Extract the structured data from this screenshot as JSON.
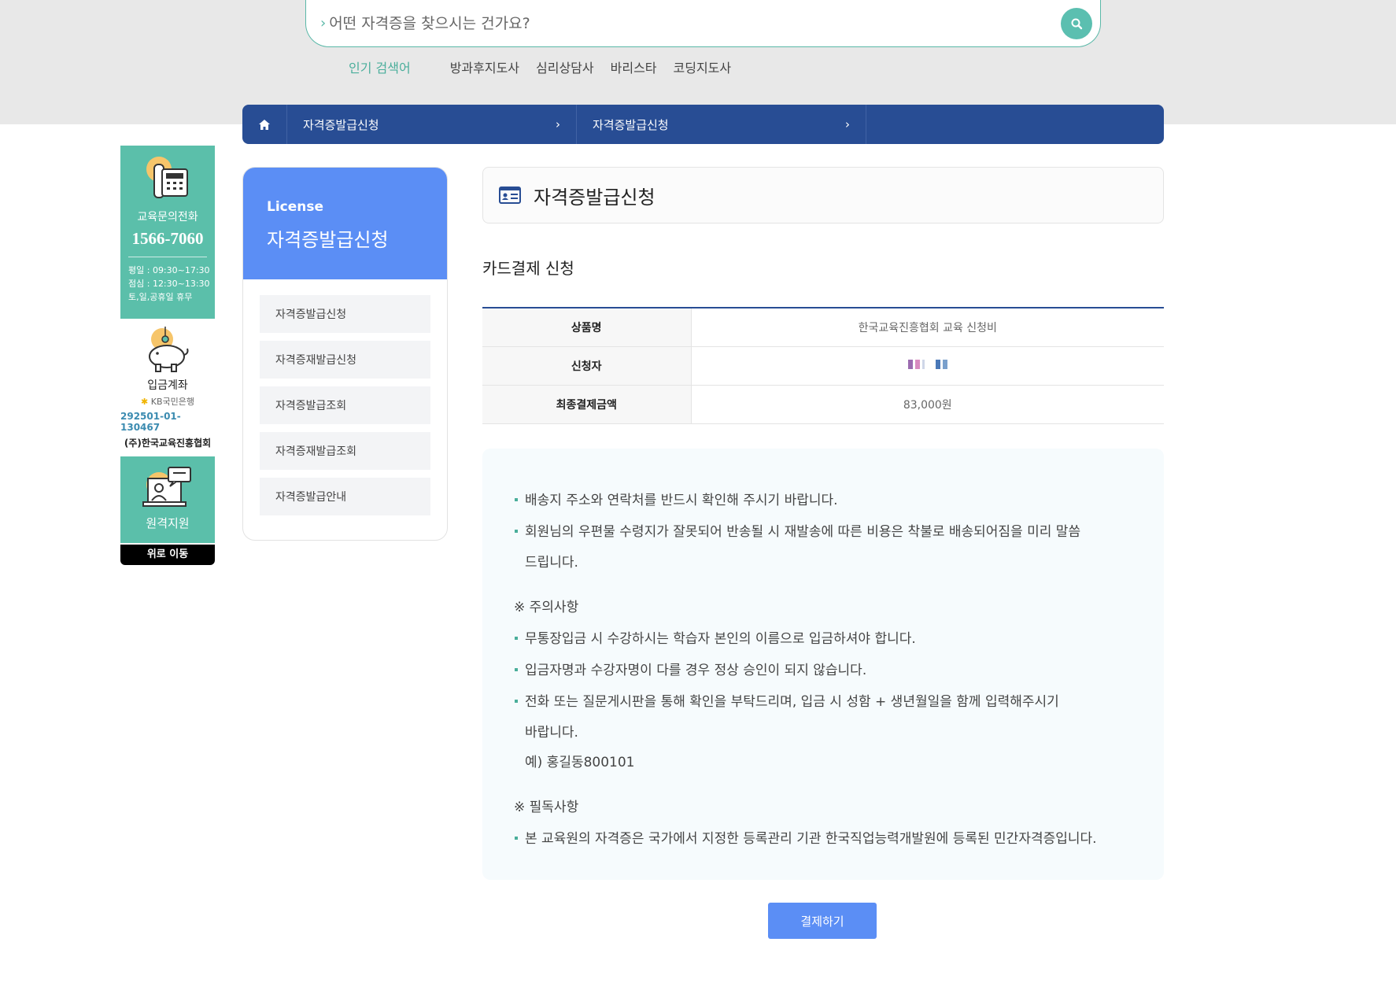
{
  "search": {
    "placeholder": "어떤 자격증을 찾으시는 건가요?"
  },
  "popular": {
    "label": "인기 검색어",
    "keywords": [
      "방과후지도사",
      "심리상담사",
      "바리스타",
      "코딩지도사"
    ]
  },
  "breadcrumb": {
    "items": [
      "자격증발급신청",
      "자격증발급신청"
    ]
  },
  "quick": {
    "phone_label": "교육문의전화",
    "phone_number": "1566-7060",
    "hours": [
      "평일 : 09:30~17:30",
      "점심 : 12:30~13:30",
      "토,일,공휴일 휴무"
    ],
    "bank_title": "입금계좌",
    "bank_name": "KB국민은행",
    "account": "292501-01-130467",
    "company": "(주)한국교육진흥협회",
    "remote": "원격지원",
    "top": "위로 이동"
  },
  "sidebar": {
    "en": "License",
    "ko": "자격증발급신청",
    "items": [
      "자격증발급신청",
      "자격증재발급신청",
      "자격증발급조회",
      "자격증재발급조회",
      "자격증발급안내"
    ]
  },
  "main": {
    "title": "자격증발급신청",
    "subtitle": "카드결제 신청",
    "table": [
      {
        "key": "상품명",
        "value": "한국교육진흥협회 교육 신청비"
      },
      {
        "key": "신청자",
        "value": ""
      },
      {
        "key": "최종결제금액",
        "value": "83,000원"
      }
    ],
    "notice": {
      "items1": [
        "배송지 주소와 연락처를 반드시 확인해 주시기 바랍니다.",
        "회원님의 우편물 수령지가 잘못되어 반송될 시 재발송에 따른 비용은 착불로 배송되어짐을 미리 말씀"
      ],
      "items1_cont": "드립니다.",
      "head1": "※ 주의사항",
      "items2": [
        "무통장입금 시 수강하시는 학습자 본인의 이름으로 입금하셔야 합니다.",
        "입금자명과 수강자명이 다를 경우 정상 승인이 되지 않습니다.",
        "전화 또는 질문게시판을 통해 확인을 부탁드리며, 입금 시 성함 + 생년월일을 함께 입력해주시기"
      ],
      "items2_cont": [
        "바랍니다.",
        "예) 홍길동800101"
      ],
      "head2": "※ 필독사항",
      "items3": [
        "본 교육원의 자격증은 국가에서 지정한 등록관리 기관 한국직업능력개발원에 등록된 민간자격증입니다."
      ]
    },
    "pay_button": "결제하기"
  },
  "colors": {
    "teal": "#5bbfaa",
    "navy": "#284d94",
    "blue": "#5b8ef5"
  }
}
